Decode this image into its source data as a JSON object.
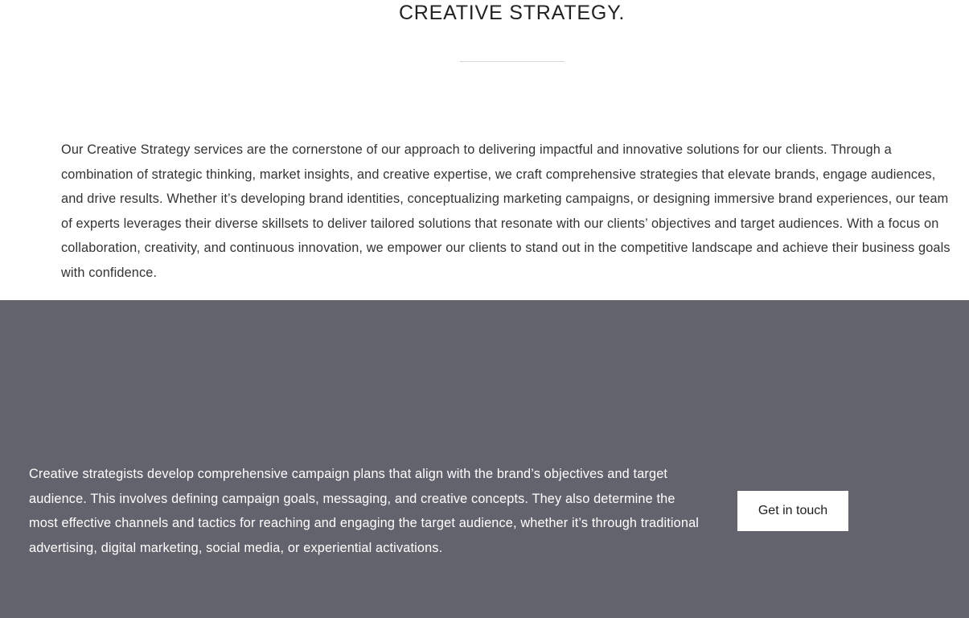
{
  "header": {
    "title": "CREATIVE STRATEGY."
  },
  "intro": {
    "text": "Our Creative Strategy services are the cornerstone of our approach to delivering impactful and innovative solutions for our clients. Through a combination of strategic thinking, market insights, and creative expertise, we craft comprehensive strategies that elevate brands, engage audiences, and drive results. Whether it’s developing brand identities, conceptualizing marketing campaigns, or designing immersive brand experiences, our team of experts leverages their diverse skillsets to deliver tailored solutions that resonate with our clients’ objectives and target audiences. With a focus on collaboration, creativity, and continuous innovation, we empower our clients to stand out in the competitive landscape and achieve their business goals with confidence."
  },
  "band": {
    "text": "Creative strategists develop comprehensive campaign plans that align with the brand’s objectives and target audience. This involves defining campaign goals, messaging, and creative concepts. They also determine the most effective channels and tactics for reaching and engaging the target audience, whether it’s through traditional advertising, digital marketing, social media, or experiential activations.",
    "cta_label": "Get in touch",
    "background_color": "#63636d"
  }
}
